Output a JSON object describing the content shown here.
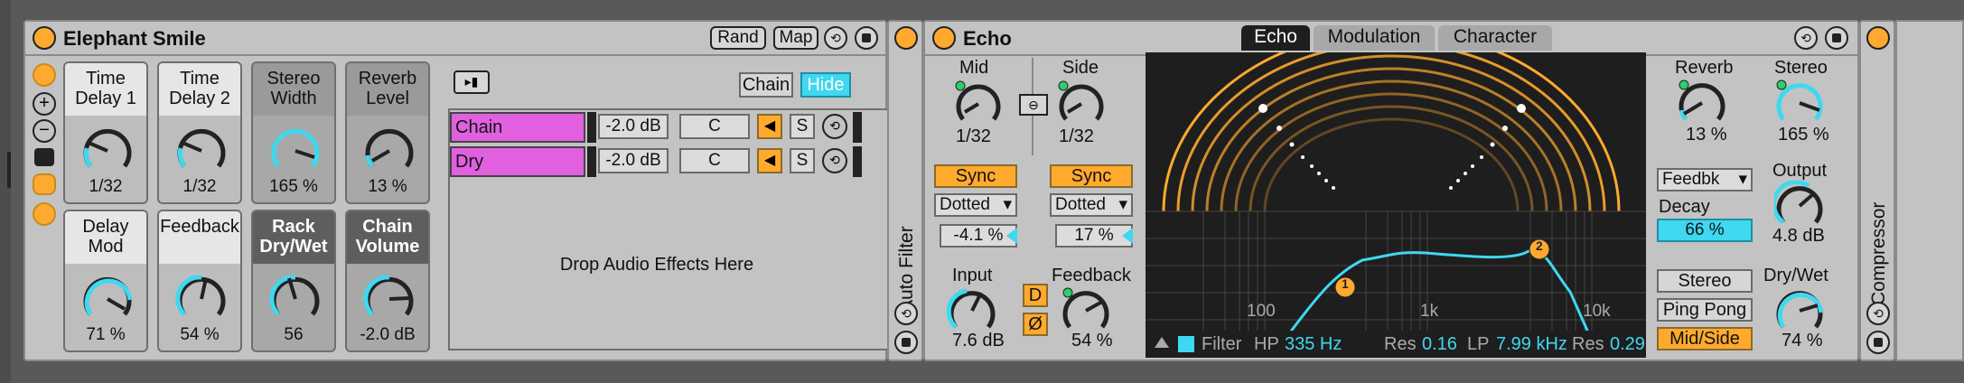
{
  "rack": {
    "title": "Elephant Smile",
    "buttons": {
      "rand": "Rand",
      "map": "Map"
    },
    "macros": [
      {
        "name": "Time Delay 1",
        "value": "1/32"
      },
      {
        "name": "Time Delay 2",
        "value": "1/32"
      },
      {
        "name": "Stereo Width",
        "value": "165 %"
      },
      {
        "name": "Reverb Level",
        "value": "13 %"
      },
      {
        "name": "Delay Mod",
        "value": "71 %"
      },
      {
        "name": "Feedback",
        "value": "54 %"
      },
      {
        "name": "Rack Dry/Wet",
        "value": "56"
      },
      {
        "name": "Chain Volume",
        "value": "-2.0 dB"
      }
    ],
    "chain_list": {
      "chain_button": "Chain",
      "hide_button": "Hide",
      "rows": [
        {
          "name": "Chain",
          "volume": "-2.0 dB",
          "pan": "C",
          "solo": "S"
        },
        {
          "name": "Dry",
          "volume": "-2.0 dB",
          "pan": "C",
          "solo": "S"
        }
      ],
      "drop_text": "Drop Audio Effects Here"
    }
  },
  "auto_filter": {
    "title": "Auto Filter"
  },
  "echo": {
    "title": "Echo",
    "tabs": [
      "Echo",
      "Modulation",
      "Character"
    ],
    "active_tab": "Echo",
    "mid": {
      "label": "Mid",
      "value": "1/32",
      "sync": "Sync",
      "mode": "Dotted",
      "offset": "-4.1 %"
    },
    "side": {
      "label": "Side",
      "value": "1/32",
      "sync": "Sync",
      "mode": "Dotted",
      "offset": "17 %"
    },
    "input": {
      "label": "Input",
      "value": "7.6 dB"
    },
    "feedback": {
      "label": "Feedback",
      "value": "54 %"
    },
    "d_button": "D",
    "phase_button": "Ø",
    "filter_bar": {
      "label": "Filter",
      "hp_label": "HP",
      "hp_value": "335 Hz",
      "res_label": "Res",
      "hp_res": "0.16",
      "lp_label": "LP",
      "lp_value": "7.99 kHz",
      "lp_res": "0.29"
    },
    "freq_labels": [
      "100",
      "1k",
      "10k"
    ],
    "markers": [
      "1",
      "2"
    ],
    "reverb": {
      "label": "Reverb",
      "value": "13 %"
    },
    "stereo": {
      "label": "Stereo",
      "value": "165 %"
    },
    "reverb_pos": "Feedbk",
    "decay": {
      "label": "Decay",
      "value": "66 %"
    },
    "output": {
      "label": "Output",
      "value": "4.8 dB"
    },
    "drywet": {
      "label": "Dry/Wet",
      "value": "74 %"
    },
    "modes": [
      "Stereo",
      "Ping Pong",
      "Mid/Side"
    ],
    "active_mode": "Mid/Side",
    "colors": {
      "accent": "#ffaa2e",
      "cyan": "#3fd8f0",
      "curve": "#3fd8f0"
    }
  },
  "compressor": {
    "title": "Compressor"
  }
}
